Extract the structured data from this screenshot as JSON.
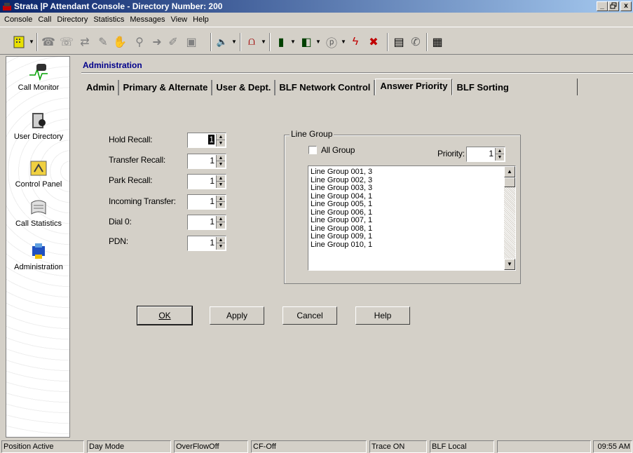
{
  "window": {
    "title": "Strata  |P  Attendant Console - Directory Number: 200",
    "minimize": "_",
    "restore": "̅□",
    "close": "x"
  },
  "menu": [
    "Console",
    "Call",
    "Directory",
    "Statistics",
    "Messages",
    "View",
    "Help"
  ],
  "sidebar": {
    "items": [
      {
        "label": "Call Monitor",
        "icon": "phone-monitor-icon"
      },
      {
        "label": "User Directory",
        "icon": "directory-icon"
      },
      {
        "label": "Control Panel",
        "icon": "control-panel-icon"
      },
      {
        "label": "Call Statistics",
        "icon": "statistics-icon"
      },
      {
        "label": "Administration",
        "icon": "administration-icon"
      }
    ]
  },
  "crumb": "Administration",
  "tabs": [
    "Admin",
    "Primary & Alternate",
    "User & Dept.",
    "BLF Network Control",
    "Answer Priority",
    "BLF Sorting"
  ],
  "active_tab": "Answer Priority",
  "fields": [
    {
      "label": "Hold Recall:",
      "value": "1"
    },
    {
      "label": "Transfer Recall:",
      "value": "1"
    },
    {
      "label": "Park Recall:",
      "value": "1"
    },
    {
      "label": "Incoming Transfer:",
      "value": "1"
    },
    {
      "label": "Dial 0:",
      "value": "1"
    },
    {
      "label": "PDN:",
      "value": "1"
    }
  ],
  "line_group": {
    "title": "Line Group",
    "all_group_label": "All Group",
    "all_group_checked": false,
    "priority_label": "Priority:",
    "priority_value": "1",
    "items": [
      "Line Group 001,  3",
      "Line Group 002,  3",
      "Line Group 003,  3",
      "Line Group 004,  1",
      "Line Group 005,  1",
      "Line Group 006,  1",
      "Line Group 007,  1",
      "Line Group 008,  1",
      "Line Group 009,  1",
      "Line Group 010,  1"
    ]
  },
  "buttons": {
    "ok": "OK",
    "apply": "Apply",
    "cancel": "Cancel",
    "help": "Help"
  },
  "status": [
    "Position Active",
    "Day Mode",
    "OverFlowOff",
    "CF-Off",
    "",
    "Trace ON",
    "BLF Local",
    "",
    "09:55 AM"
  ]
}
